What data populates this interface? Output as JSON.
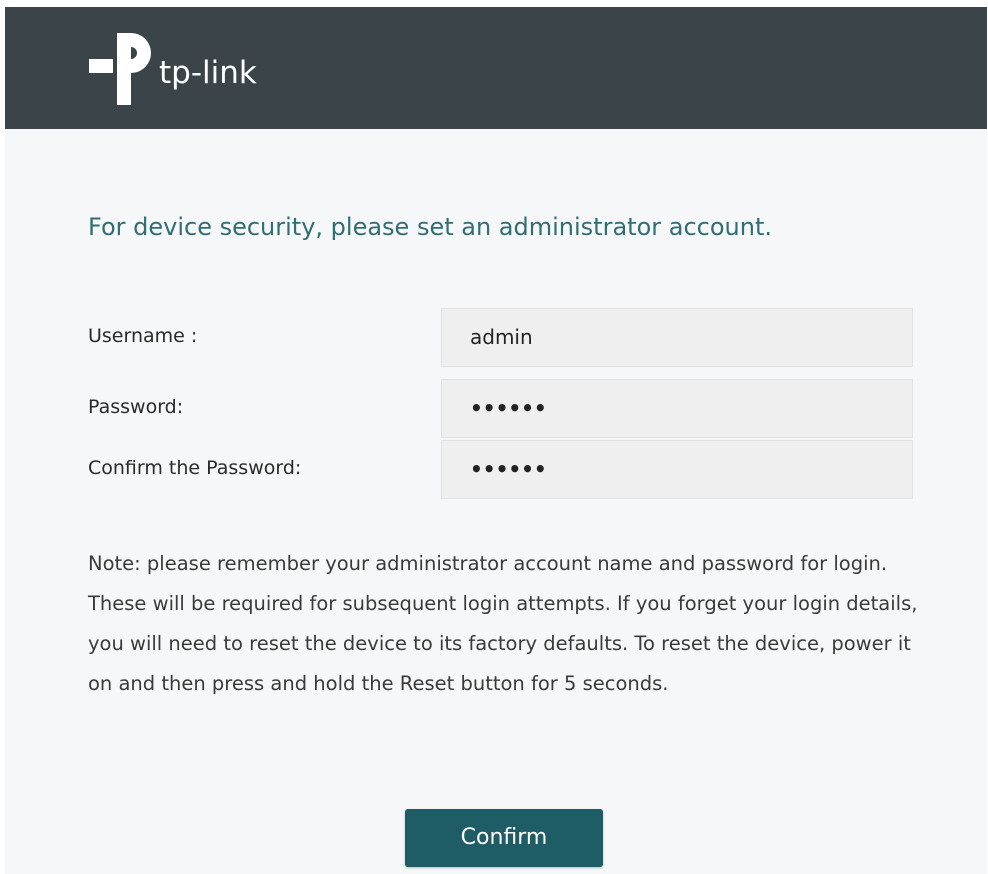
{
  "header": {
    "brand_name": "tp-link",
    "logo_icon": "tp-link-logo-icon"
  },
  "main": {
    "headline": "For device security, please set an administrator account.",
    "fields": [
      {
        "label": "Username :",
        "value": "admin",
        "type": "text"
      },
      {
        "label": "Password:",
        "value": "••••••",
        "type": "password"
      },
      {
        "label": "Confirm the Password:",
        "value": "••••••",
        "type": "password"
      }
    ],
    "note": "Note: please remember your administrator account name and password for login. These will be required for subsequent login attempts. If you forget your login details, you will need to reset the device to its factory defaults. To reset the device, power it on and then press and hold the Reset button for 5 seconds.",
    "confirm_label": "Confirm"
  },
  "colors": {
    "header_bg": "#3b4449",
    "page_bg": "#f6f7f8",
    "headline": "#2f6e73",
    "button_bg": "#1e5c66"
  }
}
